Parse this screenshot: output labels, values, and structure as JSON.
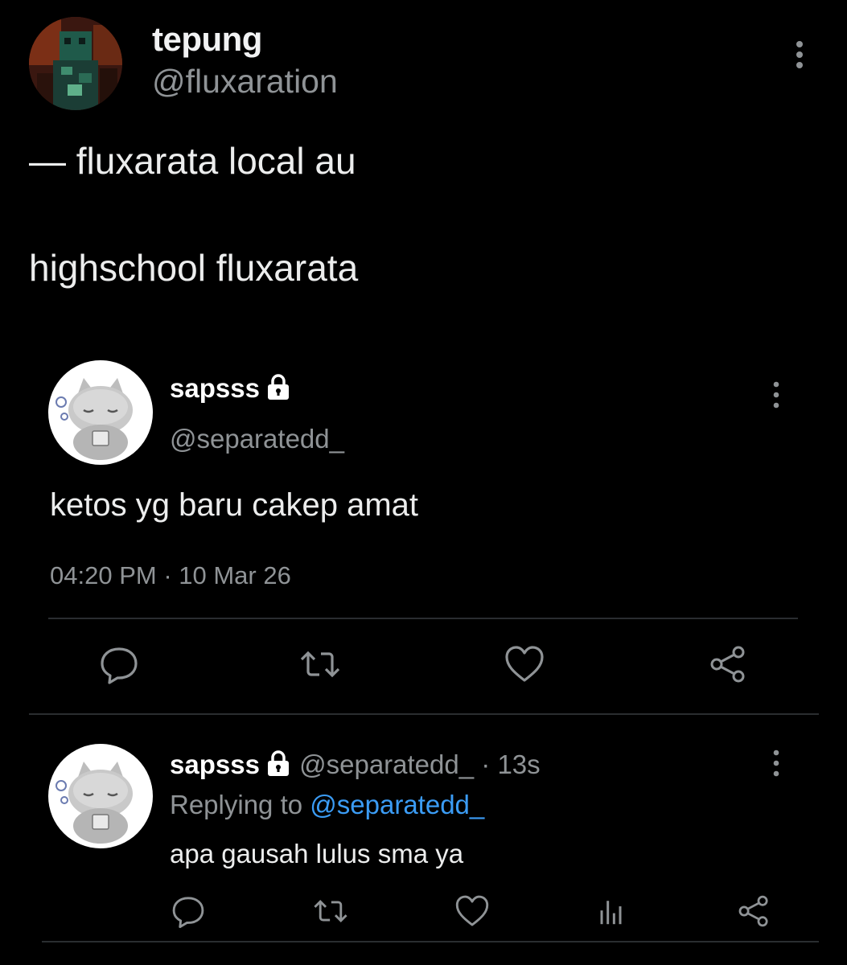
{
  "post": {
    "author_name": "tepung",
    "author_handle": "@fluxaration",
    "lines": [
      "— fluxarata local au",
      "highschool fluxarata"
    ]
  },
  "quoted": {
    "author_name": "sapsss",
    "author_handle": "@separatedd_",
    "text": "ketos yg baru cakep amat",
    "time": "04:20 PM",
    "date": "10 Mar 26",
    "meta_separator": " · "
  },
  "reply": {
    "author_name": "sapsss",
    "author_handle": "@separatedd_",
    "time_ago": "13s",
    "replying_prefix": "Replying to ",
    "replying_to": "@separatedd_",
    "text": "apa gausah lulus sma ya"
  },
  "colors": {
    "background": "#000000",
    "text": "#e7e9ea",
    "muted": "#8f9396",
    "mention": "#3b9cf5",
    "divider": "#2a2d30"
  },
  "icons": {
    "more": "vertical-ellipsis-icon",
    "lock": "lock-icon",
    "reply": "comment-bubble-icon",
    "retweet": "retweet-icon",
    "like": "heart-icon",
    "share": "share-icon",
    "views": "bar-chart-icon"
  }
}
